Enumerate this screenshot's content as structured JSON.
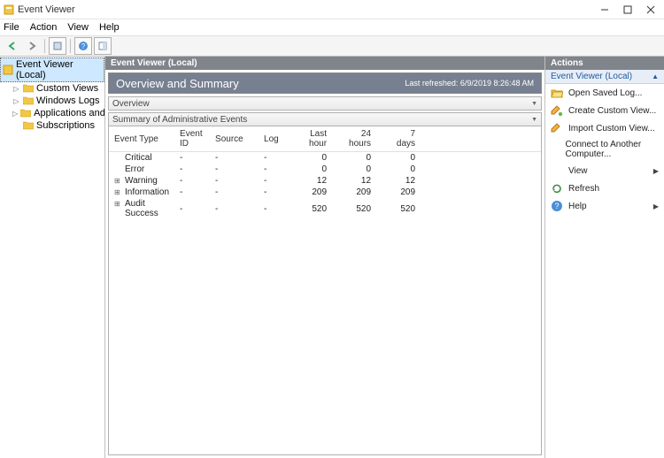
{
  "title": "Event Viewer",
  "menu": {
    "file": "File",
    "action": "Action",
    "view": "View",
    "help": "Help"
  },
  "nav": {
    "root": "Event Viewer (Local)",
    "items": [
      {
        "label": "Custom Views"
      },
      {
        "label": "Windows Logs"
      },
      {
        "label": "Applications and Services Lo"
      },
      {
        "label": "Subscriptions"
      }
    ]
  },
  "center": {
    "header": "Event Viewer (Local)",
    "title": "Overview and Summary",
    "timestamp": "Last refreshed: 6/9/2019 8:26:48 AM",
    "overview_label": "Overview",
    "summary_label": "Summary of Administrative Events",
    "cols": {
      "event_type": "Event Type",
      "event_id": "Event ID",
      "source": "Source",
      "log": "Log",
      "last_hour": "Last hour",
      "h24": "24 hours",
      "d7": "7 days"
    },
    "rows": [
      {
        "exp": "",
        "type": "Critical",
        "id": "-",
        "src": "-",
        "log": "-",
        "h1": "0",
        "h24": "0",
        "d7": "0"
      },
      {
        "exp": "",
        "type": "Error",
        "id": "-",
        "src": "-",
        "log": "-",
        "h1": "0",
        "h24": "0",
        "d7": "0"
      },
      {
        "exp": "+",
        "type": "Warning",
        "id": "-",
        "src": "-",
        "log": "-",
        "h1": "12",
        "h24": "12",
        "d7": "12"
      },
      {
        "exp": "+",
        "type": "Information",
        "id": "-",
        "src": "-",
        "log": "-",
        "h1": "209",
        "h24": "209",
        "d7": "209"
      },
      {
        "exp": "+",
        "type": "Audit Success",
        "id": "-",
        "src": "-",
        "log": "-",
        "h1": "520",
        "h24": "520",
        "d7": "520"
      }
    ]
  },
  "actions": {
    "header": "Actions",
    "sub": "Event Viewer (Local)",
    "items": [
      {
        "icon": "open",
        "label": "Open Saved Log..."
      },
      {
        "icon": "create",
        "label": "Create Custom View..."
      },
      {
        "icon": "import",
        "label": "Import Custom View..."
      },
      {
        "icon": "",
        "label": "Connect to Another Computer..."
      },
      {
        "icon": "",
        "label": "View",
        "arrow": true
      },
      {
        "icon": "refresh",
        "label": "Refresh"
      },
      {
        "icon": "help",
        "label": "Help",
        "arrow": true
      }
    ]
  }
}
